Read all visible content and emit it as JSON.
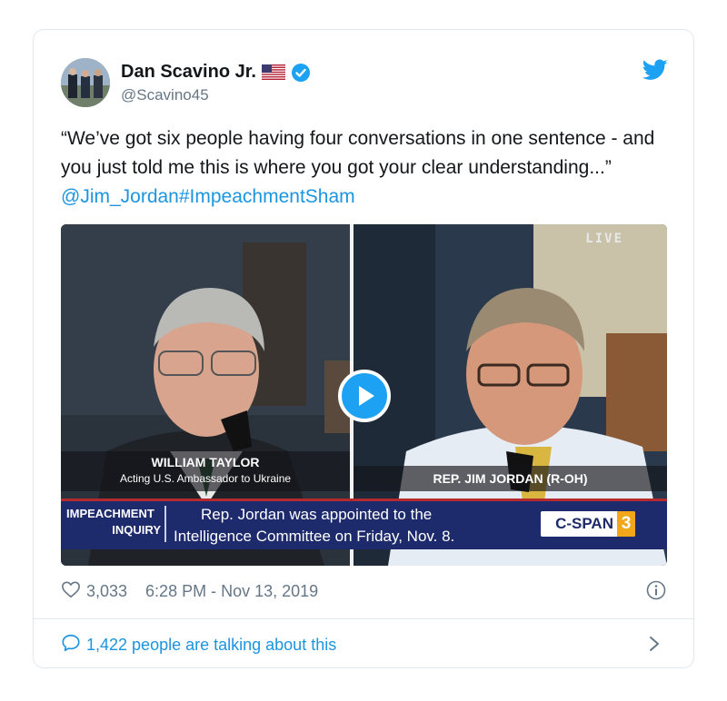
{
  "tweet": {
    "author_name": "Dan Scavino Jr.",
    "handle": "@Scavino45",
    "text_main": "“We’ve got six people having four conversations in one sentence - and you just told me this is where you got your clear understanding...”",
    "mention": "@Jim_Jordan",
    "hashtag": "#ImpeachmentSham",
    "likes": "3,033",
    "timestamp": "6:28 PM - Nov 13, 2019",
    "talking": "1,422 people are talking about this"
  },
  "video": {
    "live_label": "LIVE",
    "left_name": "WILLIAM TAYLOR",
    "left_title": "Acting U.S. Ambassador to Ukraine",
    "right_name": "REP. JIM JORDAN (R-OH)",
    "banner_tag_line1": "IMPEACHMENT",
    "banner_tag_line2": "INQUIRY",
    "banner_line1": "Rep. Jordan was appointed to the",
    "banner_line2": "Intelligence Committee on Friday, Nov. 8.",
    "channel_logo": "C-SPAN",
    "channel_number": "3"
  },
  "icons": {
    "verified": "verified-badge-icon",
    "twitter": "twitter-bird-icon",
    "heart": "heart-icon",
    "info": "info-icon",
    "reply": "speech-bubble-icon",
    "chevron": "chevron-right-icon",
    "play": "play-icon",
    "flag": "us-flag-icon"
  },
  "colors": {
    "link": "#1b95e0",
    "secondary_text": "#657786",
    "verified": "#1da1f2",
    "banner_bg": "#1d2a6b",
    "banner_red": "#b52a2e"
  }
}
